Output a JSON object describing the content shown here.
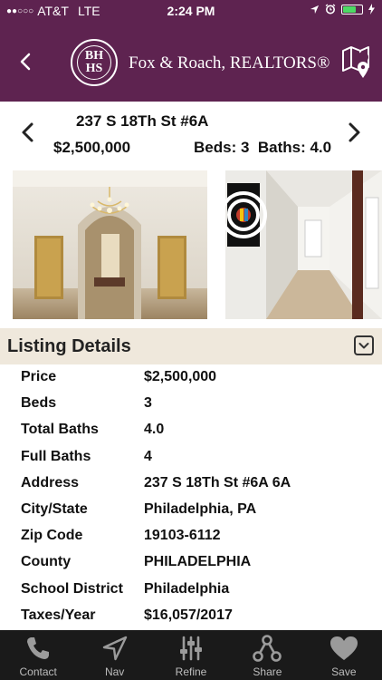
{
  "status": {
    "carrier": "AT&T",
    "network": "LTE",
    "time": "2:24 PM"
  },
  "header": {
    "logo_top": "BH",
    "logo_bottom": "HS",
    "brand": "Fox & Roach, REALTORS®"
  },
  "listing": {
    "address": "237 S 18Th St #6A",
    "price": "$2,500,000",
    "beds_baths": "Beds: 3  Baths: 4.0"
  },
  "details": {
    "title": "Listing Details",
    "rows": [
      {
        "label": "Price",
        "value": "$2,500,000"
      },
      {
        "label": "Beds",
        "value": "3"
      },
      {
        "label": "Total Baths",
        "value": "4.0"
      },
      {
        "label": "Full Baths",
        "value": "4"
      },
      {
        "label": "Address",
        "value": "237 S 18Th St #6A 6A"
      },
      {
        "label": "City/State",
        "value": "Philadelphia, PA"
      },
      {
        "label": "Zip Code",
        "value": "19103-6112"
      },
      {
        "label": "County",
        "value": "PHILADELPHIA"
      },
      {
        "label": "School District",
        "value": "Philadelphia"
      },
      {
        "label": "Taxes/Year",
        "value": "$16,057/2017"
      }
    ]
  },
  "tabs": [
    {
      "label": "Contact",
      "icon": "phone-icon"
    },
    {
      "label": "Nav",
      "icon": "navigation-arrow-icon"
    },
    {
      "label": "Refine",
      "icon": "sliders-icon"
    },
    {
      "label": "Share",
      "icon": "share-icon"
    },
    {
      "label": "Save",
      "icon": "heart-icon"
    }
  ],
  "colors": {
    "brand_purple": "#5e2350",
    "details_header_bg": "#efe8dc",
    "tabbar_bg": "#1a1a1a",
    "battery_green": "#4cd964"
  }
}
